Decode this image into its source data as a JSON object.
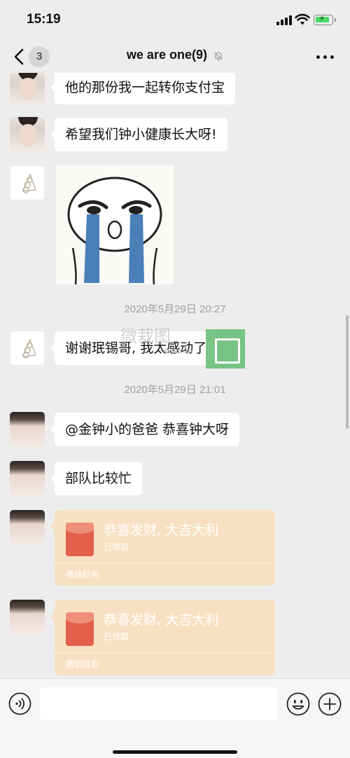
{
  "status_bar": {
    "time": "15:19",
    "battery_color": "#4cd964"
  },
  "nav": {
    "unread_count": "3",
    "title": "we are one(9)",
    "icons": {
      "back": "chevron-left-icon",
      "mute": "bell-slash-icon",
      "more": "more-dots-icon"
    }
  },
  "messages": [
    {
      "type": "text",
      "text": "他的那份我一起转你支付宝"
    },
    {
      "type": "text",
      "text": "希望我们钟小健康长大呀!"
    },
    {
      "type": "sticker",
      "description_icon": "crying-face-sticker"
    },
    {
      "type": "timestamp",
      "text": "2020年5月29日 20:27"
    },
    {
      "type": "text",
      "text": "谢谢珉锡哥, 我太感动了"
    },
    {
      "type": "timestamp",
      "text": "2020年5月29日 21:01"
    },
    {
      "type": "text",
      "text": "@金钟小的爸爸 恭喜钟大呀"
    },
    {
      "type": "text",
      "text": "部队比较忙"
    },
    {
      "type": "red_packet",
      "title": "恭喜发财, 大吉大利",
      "status": "已领取",
      "label": "微信红包"
    },
    {
      "type": "red_packet",
      "title": "恭喜发财, 大吉大利",
      "status": "已领取",
      "label": "微信红包"
    }
  ],
  "watermark": {
    "text": "微栽图",
    "url": "vjietu.com",
    "color": "#62bb71"
  },
  "colors": {
    "background": "#ededed",
    "bubble": "#ffffff",
    "red_packet": "#f8e1c3",
    "red_packet_icon": "#e45f4a"
  },
  "input_bar": {
    "value": "",
    "icons": {
      "voice": "voice-icon",
      "emoji": "emoji-icon",
      "add": "plus-circle-icon"
    }
  }
}
